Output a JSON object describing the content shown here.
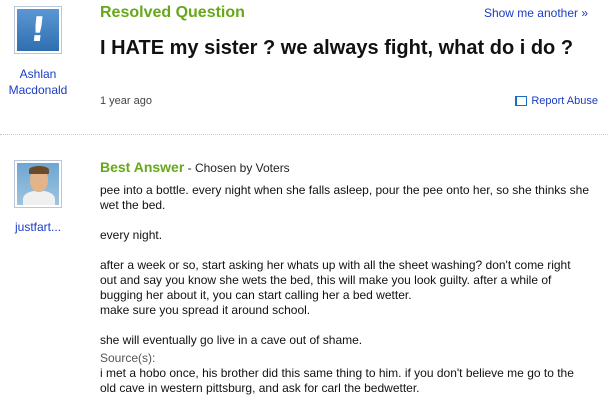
{
  "question": {
    "status": "Resolved Question",
    "show_more": "Show me another »",
    "title": "I HATE my sister ? we always fight, what do i do ?",
    "time": "1 year ago",
    "report": "Report Abuse",
    "asker": {
      "name_line1": "Ashlan",
      "name_line2": "Macdonald"
    },
    "avatar_icon": "exclamation-avatar-icon"
  },
  "answer": {
    "best_label": "Best Answer",
    "chosen_by": " - Chosen by Voters",
    "answerer": "justfart...",
    "paragraphs": [
      "pee into a bottle. every night when she falls asleep, pour the pee onto her, so she thinks she wet the bed.",
      "every night.",
      "after a week or so, start asking her whats up with all the sheet washing? don't come right out and say you know she wets the bed, this will make you look guilty. after a while of bugging her about it, you can start calling her a bed wetter.\nmake sure you spread it around school.",
      "she will eventually go live in a cave out of shame."
    ],
    "sources_label": "Source(s):",
    "sources_text": "i met a hobo once, his brother did this same thing to him. if you don't believe me go to the old cave in western pittsburg, and ask for carl the bedwetter."
  },
  "colors": {
    "accent_green": "#66a81a",
    "link_blue": "#1a3cc5"
  }
}
